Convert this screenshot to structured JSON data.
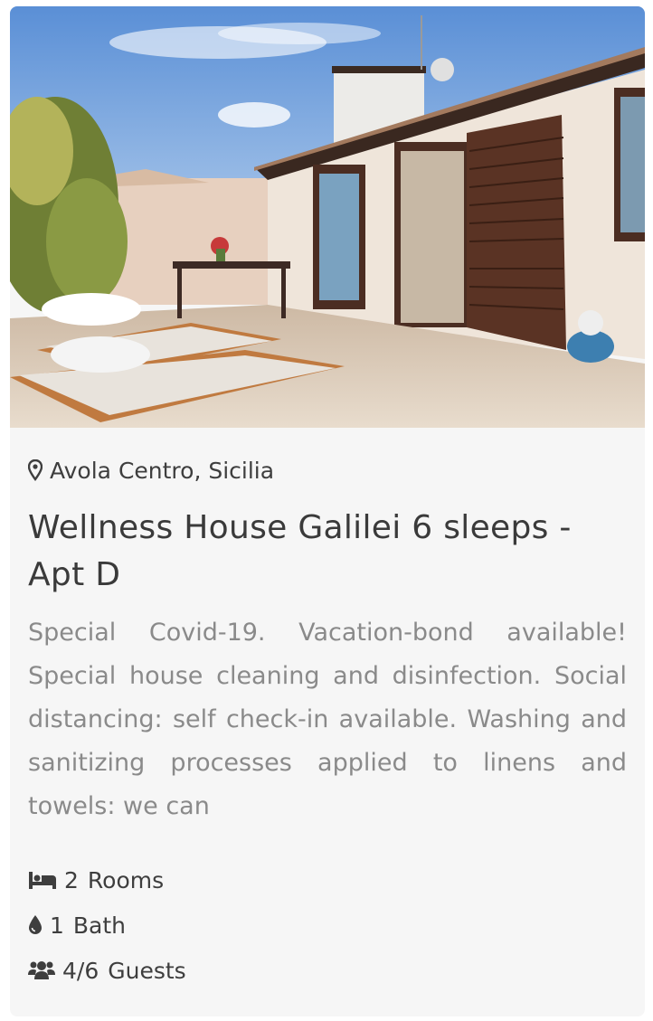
{
  "listing": {
    "location": "Avola Centro, Sicilia",
    "title": "Wellness House Galilei 6 sleeps - Apt D",
    "description": "Special Covid-19. Vacation-bond available! Special house cleaning and disinfection. Social distancing: self check-in available. Washing and sanitizing processes applied to linens and towels: we can",
    "features": {
      "rooms": {
        "icon": "bed-icon",
        "count": "2",
        "label": "Rooms"
      },
      "baths": {
        "icon": "droplet-icon",
        "count": "1",
        "label": "Bath"
      },
      "guests": {
        "icon": "users-icon",
        "count": "4/6",
        "label": "Guests"
      }
    }
  },
  "colors": {
    "card_background": "#f6f6f6",
    "title_text": "#3a3a3a",
    "description_text": "#8a8a8a"
  }
}
